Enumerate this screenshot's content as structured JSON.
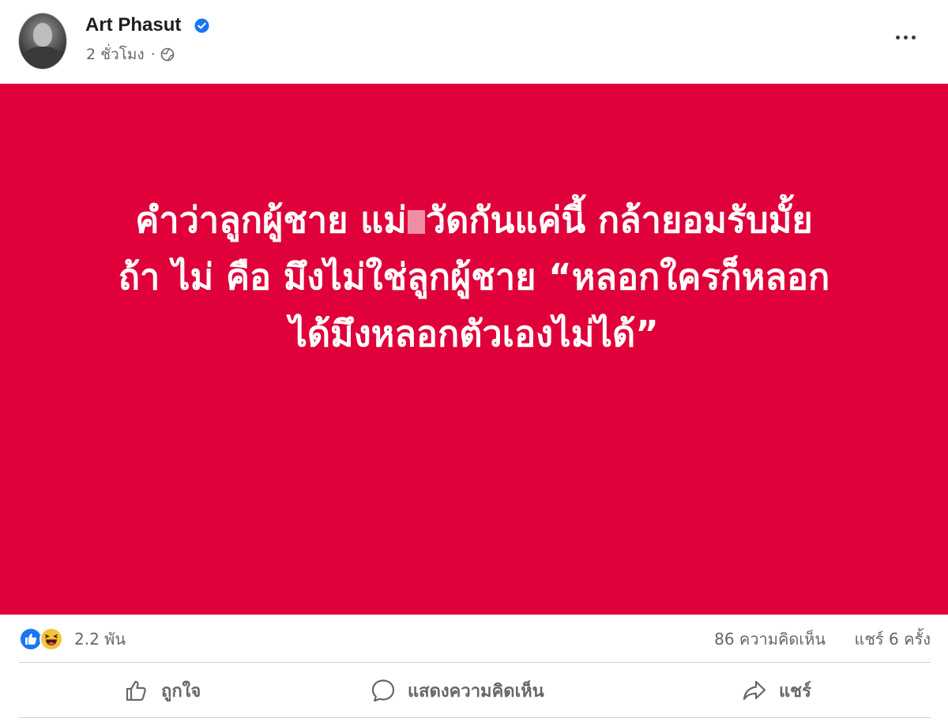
{
  "post": {
    "author": "Art Phasut",
    "time": "2 ชั่วโมง",
    "privacy_icon": "globe-icon",
    "verified_icon": "verified-badge-icon",
    "text_lines": [
      {
        "before": "คำว่าลูกผู้ชาย แม่",
        "after": "วัดกันแค่นี้ กล้ายอมรับมั้ย"
      },
      {
        "text": "ถ้า ไม่ คือ มึงไม่ใช่ลูกผู้ชาย “หลอกใครก็หลอก"
      },
      {
        "text": "ได้มึงหลอกตัวเองไม่ได้”"
      }
    ],
    "background_color": "#e0003a"
  },
  "stats": {
    "reaction_count": "2.2 พัน",
    "comments": "86 ความคิดเห็น",
    "shares": "แชร์ 6 ครั้ง",
    "reaction_icons": [
      "like-icon",
      "haha-icon"
    ]
  },
  "actions": {
    "like": "ถูกใจ",
    "comment": "แสดงความคิดเห็น",
    "share": "แชร์"
  },
  "colors": {
    "accent": "#1877f2",
    "muted_text": "#65676b"
  }
}
